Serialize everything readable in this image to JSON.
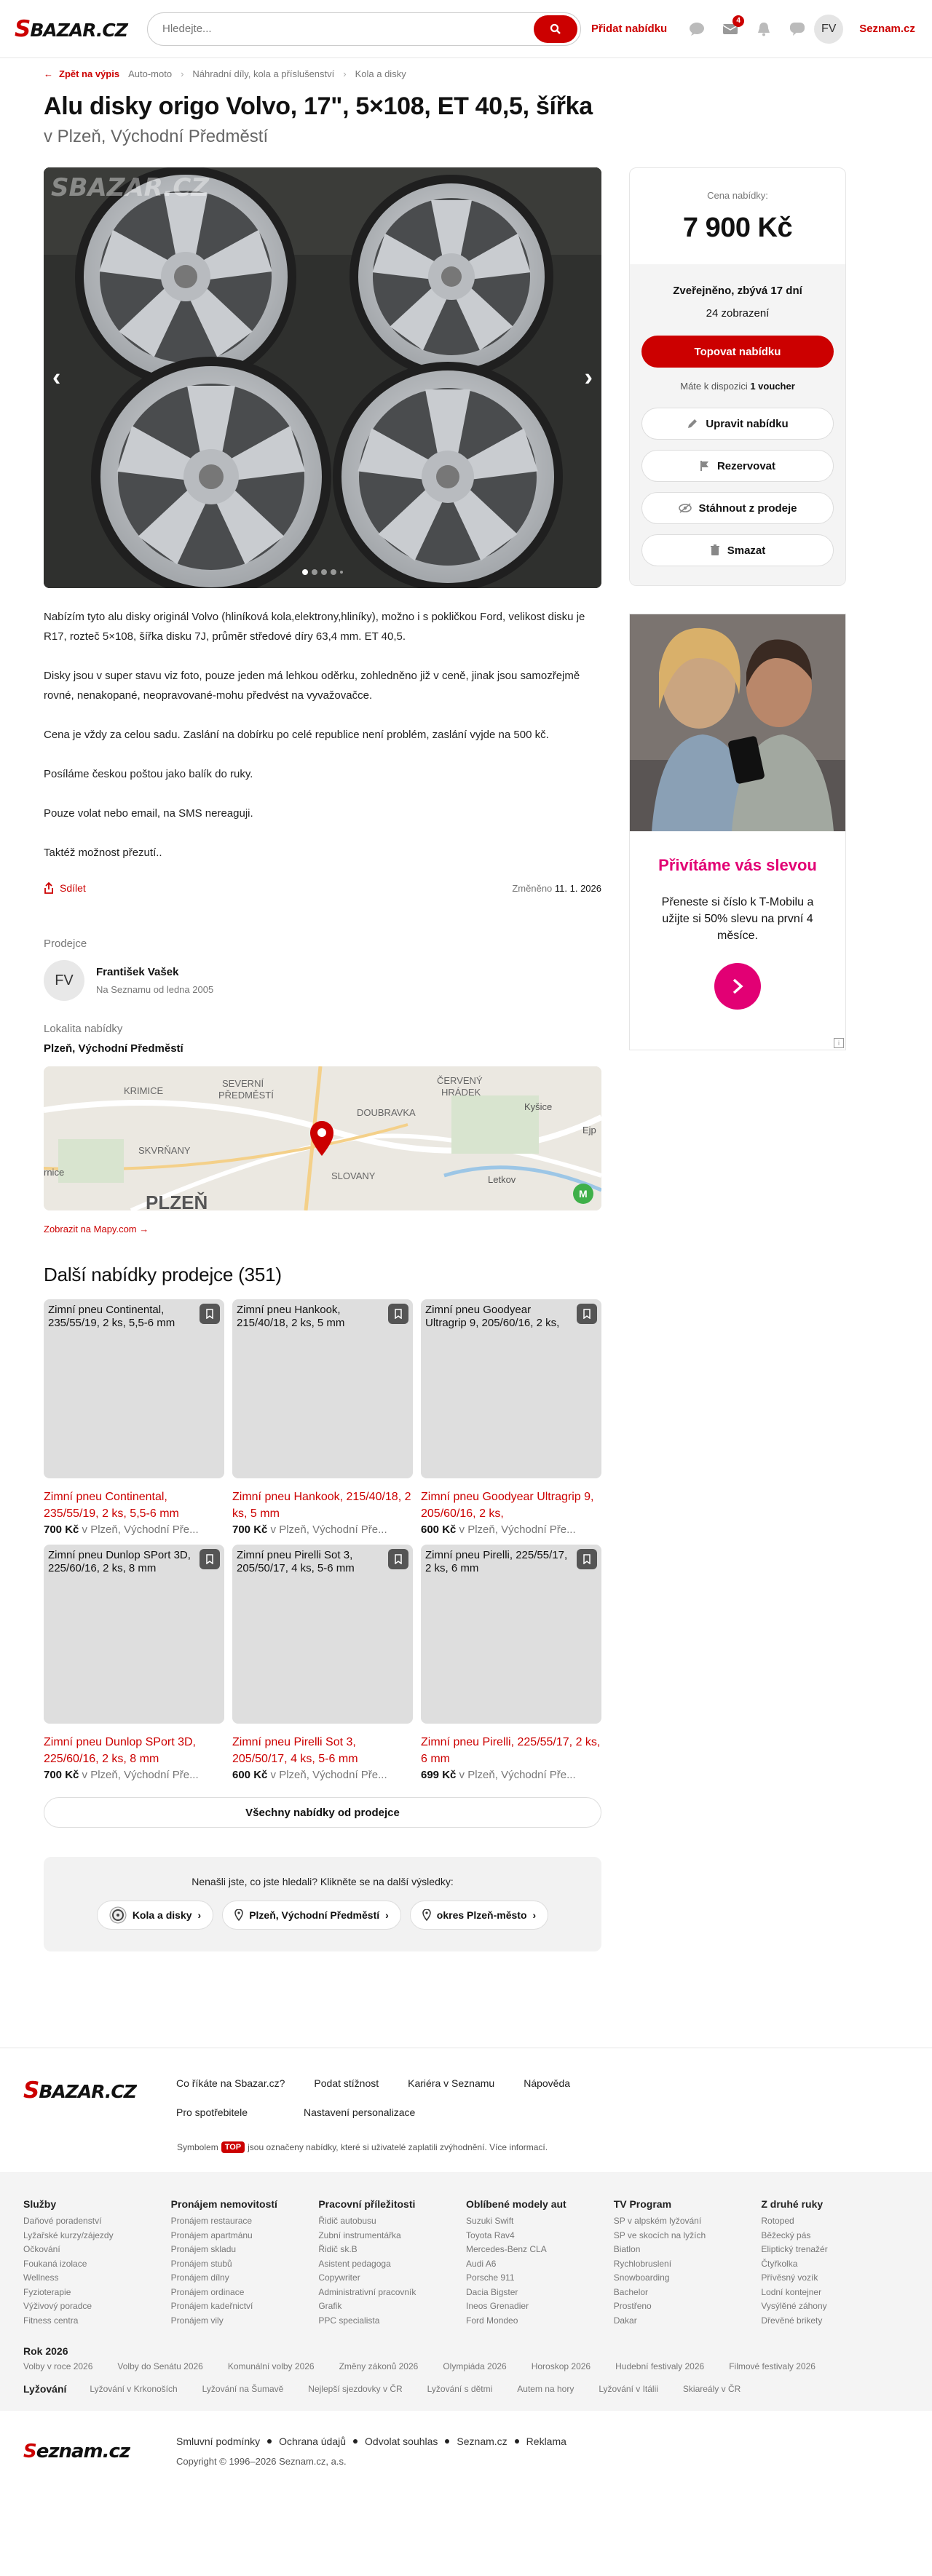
{
  "header": {
    "logo": "SBAZAR.CZ",
    "search_placeholder": "Hledejte...",
    "add_ad": "Přidat nabídku",
    "badge_count": "4",
    "avatar": "FV",
    "seznam": "Seznam.cz"
  },
  "breadcrumb": {
    "back": "Zpět na výpis",
    "items": [
      "Auto-moto",
      "Náhradní díly, kola a příslušenství",
      "Kola a disky"
    ]
  },
  "listing": {
    "title": "Alu disky origo Volvo, 17\", 5×108, ET 40,5, šířka",
    "location_sub": "v Plzeň, Východní Předměstí",
    "photo_watermark": "SBAZAR.CZ",
    "description": [
      "Nabízím tyto alu disky originál Volvo (hliníková kola,elektrony,hliníky), možno i s pokličkou Ford, velikost disku je R17, rozteč 5×108, šířka disku 7J, průměr středové díry 63,4 mm. ET 40,5.",
      "Disky jsou v super stavu viz foto, pouze jeden má lehkou oděrku, zohledněno již v ceně, jinak jsou samozřejmě rovné, nenakopané, neopravované-mohu předvést na vyvažovačce.",
      "Cena je vždy za celou sadu. Zaslání na dobírku po celé republice není problém, zaslání vyjde na 500 kč.",
      "Posíláme českou poštou jako balík do ruky.",
      "Pouze volat nebo email, na SMS nereaguji.",
      "Taktéž možnost přezutí.."
    ],
    "share": "Sdílet",
    "changed_label": "Změněno",
    "changed_date": "11. 1. 2026"
  },
  "seller": {
    "section": "Prodejce",
    "initials": "FV",
    "name": "František Vašek",
    "since": "Na Seznamu od ledna 2005"
  },
  "location": {
    "section": "Lokalita nabídky",
    "name": "Plzeň, Východní Předměstí",
    "map_labels": [
      "KRIMICE",
      "SEVERNÍ",
      "PŘEDMĚSTÍ",
      "ČERVENÝ",
      "HRÁDEK",
      "DOUBRAVKA",
      "Kyšice",
      "SKVRŇANY",
      "SLOVANY",
      "Letkov",
      "PLZEŇ",
      "rnice",
      "Ejp"
    ],
    "map_link": "Zobrazit na Mapy.com →"
  },
  "more": {
    "title": "Další nabídky prodejce (351)",
    "items": [
      {
        "alt": "Zimní pneu Continental, 235/55/19, 2 ks, 5,5-6 mm",
        "title": "Zimní pneu Continental, 235/55/19, 2 ks, 5,5-6 mm",
        "price": "700 Kč",
        "loc": "v Plzeň, Východní Pře..."
      },
      {
        "alt": "Zimní pneu Hankook, 215/40/18, 2 ks, 5 mm",
        "title": "Zimní pneu Hankook, 215/40/18, 2 ks, 5 mm",
        "price": "700 Kč",
        "loc": "v Plzeň, Východní Pře..."
      },
      {
        "alt": "Zimní pneu Goodyear Ultragrip 9, 205/60/16, 2 ks,",
        "title": "Zimní pneu Goodyear Ultragrip 9, 205/60/16, 2 ks,",
        "price": "600 Kč",
        "loc": "v Plzeň, Východní Pře..."
      },
      {
        "alt": "Zimní pneu Dunlop SPort 3D, 225/60/16, 2 ks, 8 mm",
        "title": "Zimní pneu Dunlop SPort 3D, 225/60/16, 2 ks, 8 mm",
        "price": "700 Kč",
        "loc": "v Plzeň, Východní Pře..."
      },
      {
        "alt": "Zimní pneu Pirelli Sot 3, 205/50/17, 4 ks, 5-6 mm",
        "title": "Zimní pneu Pirelli Sot 3, 205/50/17, 4 ks, 5-6 mm",
        "price": "600 Kč",
        "loc": "v Plzeň, Východní Pře..."
      },
      {
        "alt": "Zimní pneu Pirelli, 225/55/17, 2 ks, 6 mm",
        "title": "Zimní pneu Pirelli, 225/55/17, 2 ks, 6 mm",
        "price": "699 Kč",
        "loc": "v Plzeň, Východní Pře..."
      }
    ],
    "all_button": "Všechny nabídky od prodejce"
  },
  "suggest": {
    "question": "Nenašli jste, co jste hledali? Klikněte se na další výsledky:",
    "chips": [
      "Kola a disky",
      "Plzeň, Východní Předměstí",
      "okres Plzeň-město"
    ]
  },
  "panel": {
    "price_label": "Cena nabídky:",
    "price": "7 900 Kč",
    "published": "Zveřejněno, zbývá 17 dní",
    "views": "24 zobrazení",
    "top_button": "Topovat nabídku",
    "voucher_text": "Máte k dispozici",
    "voucher_count": "1 voucher",
    "actions": [
      "Upravit nabídku",
      "Rezervovat",
      "Stáhnout z prodeje",
      "Smazat"
    ]
  },
  "ad": {
    "title": "Přivítáme vás slevou",
    "text": "Přeneste si číslo k T-Mobilu a užijte si 50% slevu na první 4 měsíce."
  },
  "footer": {
    "top_links": [
      "Co říkáte na Sbazar.cz?",
      "Podat stížnost",
      "Kariéra v Seznamu",
      "Nápověda",
      "Pro spotřebitele",
      "Nastavení personalizace"
    ],
    "symbol_pre": "Symbolem",
    "symbol_badge": "TOP",
    "symbol_post": "jsou označeny nabídky, které si uživatelé zaplatili zvýhodnění. Více informací.",
    "columns": [
      {
        "title": "Služby",
        "items": [
          "Daňové poradenství",
          "Lyžařské kurzy/zájezdy",
          "Očkování",
          "Foukaná izolace",
          "Wellness",
          "Fyzioterapie",
          "Výživový poradce",
          "Fitness centra"
        ]
      },
      {
        "title": "Pronájem nemovitostí",
        "items": [
          "Pronájem restaurace",
          "Pronájem apartmánu",
          "Pronájem skladu",
          "Pronájem stubů",
          "Pronájem dílny",
          "Pronájem ordinace",
          "Pronájem kadeřnictví",
          "Pronájem vily"
        ]
      },
      {
        "title": "Pracovní příležitosti",
        "items": [
          "Řidič autobusu",
          "Zubní instrumentářka",
          "Řidič sk.B",
          "Asistent pedagoga",
          "Copywriter",
          "Administrativní pracovník",
          "Grafik",
          "PPC specialista"
        ]
      },
      {
        "title": "Oblíbené modely aut",
        "items": [
          "Suzuki Swift",
          "Toyota Rav4",
          "Mercedes-Benz CLA",
          "Audi A6",
          "Porsche 911",
          "Dacia Bigster",
          "Ineos Grenadier",
          "Ford Mondeo"
        ]
      },
      {
        "title": "TV Program",
        "items": [
          "SP v alpském lyžování",
          "SP ve skocích na lyžích",
          "Biatlon",
          "Rychlobruslení",
          "Snowboarding",
          "Bachelor",
          "Prostřeno",
          "Dakar"
        ]
      },
      {
        "title": "Z druhé ruky",
        "items": [
          "Rotoped",
          "Běžecký pás",
          "Eliptický trenažér",
          "Čtyřkolka",
          "Přívěsný vozík",
          "Lodní kontejner",
          "Vysýlěné záhony",
          "Dřevěné brikety"
        ]
      }
    ],
    "year_title": "Rok 2026",
    "year_links": [
      "Volby v roce 2026",
      "Volby do Senátu 2026",
      "Komunální volby 2026",
      "Změny zákonů 2026",
      "Olympiáda 2026",
      "Horoskop 2026",
      "Hudební festivaly 2026",
      "Filmové festivaly 2026"
    ],
    "ski_title": "Lyžování",
    "ski_links": [
      "Lyžování v Krkonoších",
      "Lyžování na Šumavě",
      "Nejlepší sjezdovky v ČR",
      "Lyžování s dětmi",
      "Autem na hory",
      "Lyžování v Itálii",
      "Skiareály v ČR"
    ],
    "bottom_logo": "Seznam.cz",
    "bottom_links": [
      "Smluvní podmínky",
      "Ochrana údajů",
      "Odvolat souhlas",
      "Seznam.cz",
      "Reklama"
    ],
    "copyright": "Copyright © 1996–2026 Seznam.cz, a.s."
  }
}
